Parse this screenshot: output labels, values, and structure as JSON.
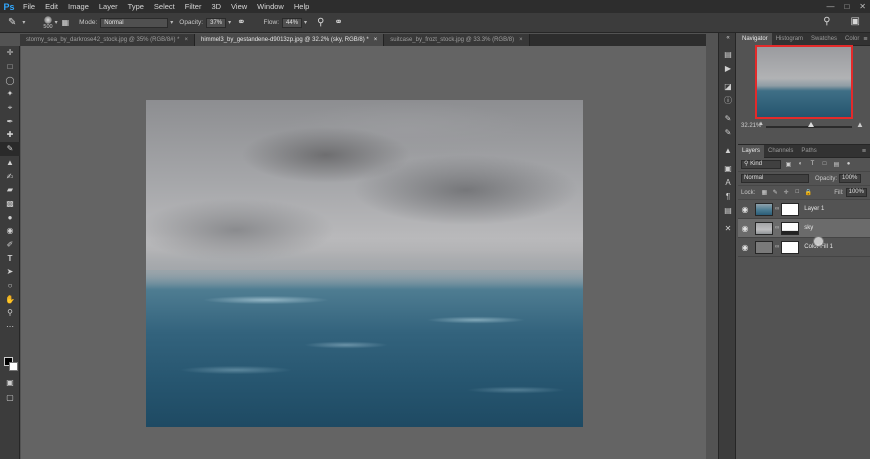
{
  "app": {
    "logo": "Ps",
    "menu": [
      "File",
      "Edit",
      "Image",
      "Layer",
      "Type",
      "Select",
      "Filter",
      "3D",
      "View",
      "Window",
      "Help"
    ],
    "window_controls": [
      "minimize-icon",
      "restore-icon",
      "close-icon"
    ]
  },
  "options_bar": {
    "brush_size": "500",
    "mode_label": "Mode:",
    "mode_value": "Normal",
    "opacity_label": "Opacity:",
    "opacity_value": "37%",
    "flow_label": "Flow:",
    "flow_value": "44%",
    "right_icons": [
      "search-icon",
      "workspace-icon"
    ]
  },
  "tabs": [
    {
      "label": "stormy_sea_by_darkrose42_stock.jpg @ 35% (RGB/8#) *",
      "active": false
    },
    {
      "label": "himmel3_by_gestandene-d9013zp.jpg @ 32.2% (sky, RGB/8) *",
      "active": true
    },
    {
      "label": "suitcase_by_frozt_stock.jpg @ 33.3% (RGB/8)",
      "active": false
    }
  ],
  "tab_close": "×",
  "tools": [
    "move-tool",
    "marquee-tool",
    "lasso-tool",
    "quick-select-tool",
    "crop-tool",
    "eyedropper-tool",
    "healing-tool",
    "brush-tool",
    "stamp-tool",
    "history-brush-tool",
    "eraser-tool",
    "gradient-tool",
    "blur-tool",
    "dodge-tool",
    "pen-tool",
    "type-tool",
    "path-select-tool",
    "shape-tool",
    "hand-tool",
    "zoom-tool",
    "more-tools"
  ],
  "navigator": {
    "tabs": [
      "Navigator",
      "Histogram",
      "Swatches",
      "Color"
    ],
    "zoom": "32.21%"
  },
  "layers": {
    "tabs": [
      "Layers",
      "Channels",
      "Paths"
    ],
    "kind_label": "Kind",
    "blend_mode": "Normal",
    "opacity_label": "Opacity:",
    "opacity_value": "100%",
    "lock_label": "Lock:",
    "fill_label": "Fill:",
    "fill_value": "100%",
    "items": [
      {
        "name": "Layer 1",
        "selected": false
      },
      {
        "name": "sky",
        "selected": true
      },
      {
        "name": "Color Fill 1",
        "selected": false
      }
    ]
  }
}
